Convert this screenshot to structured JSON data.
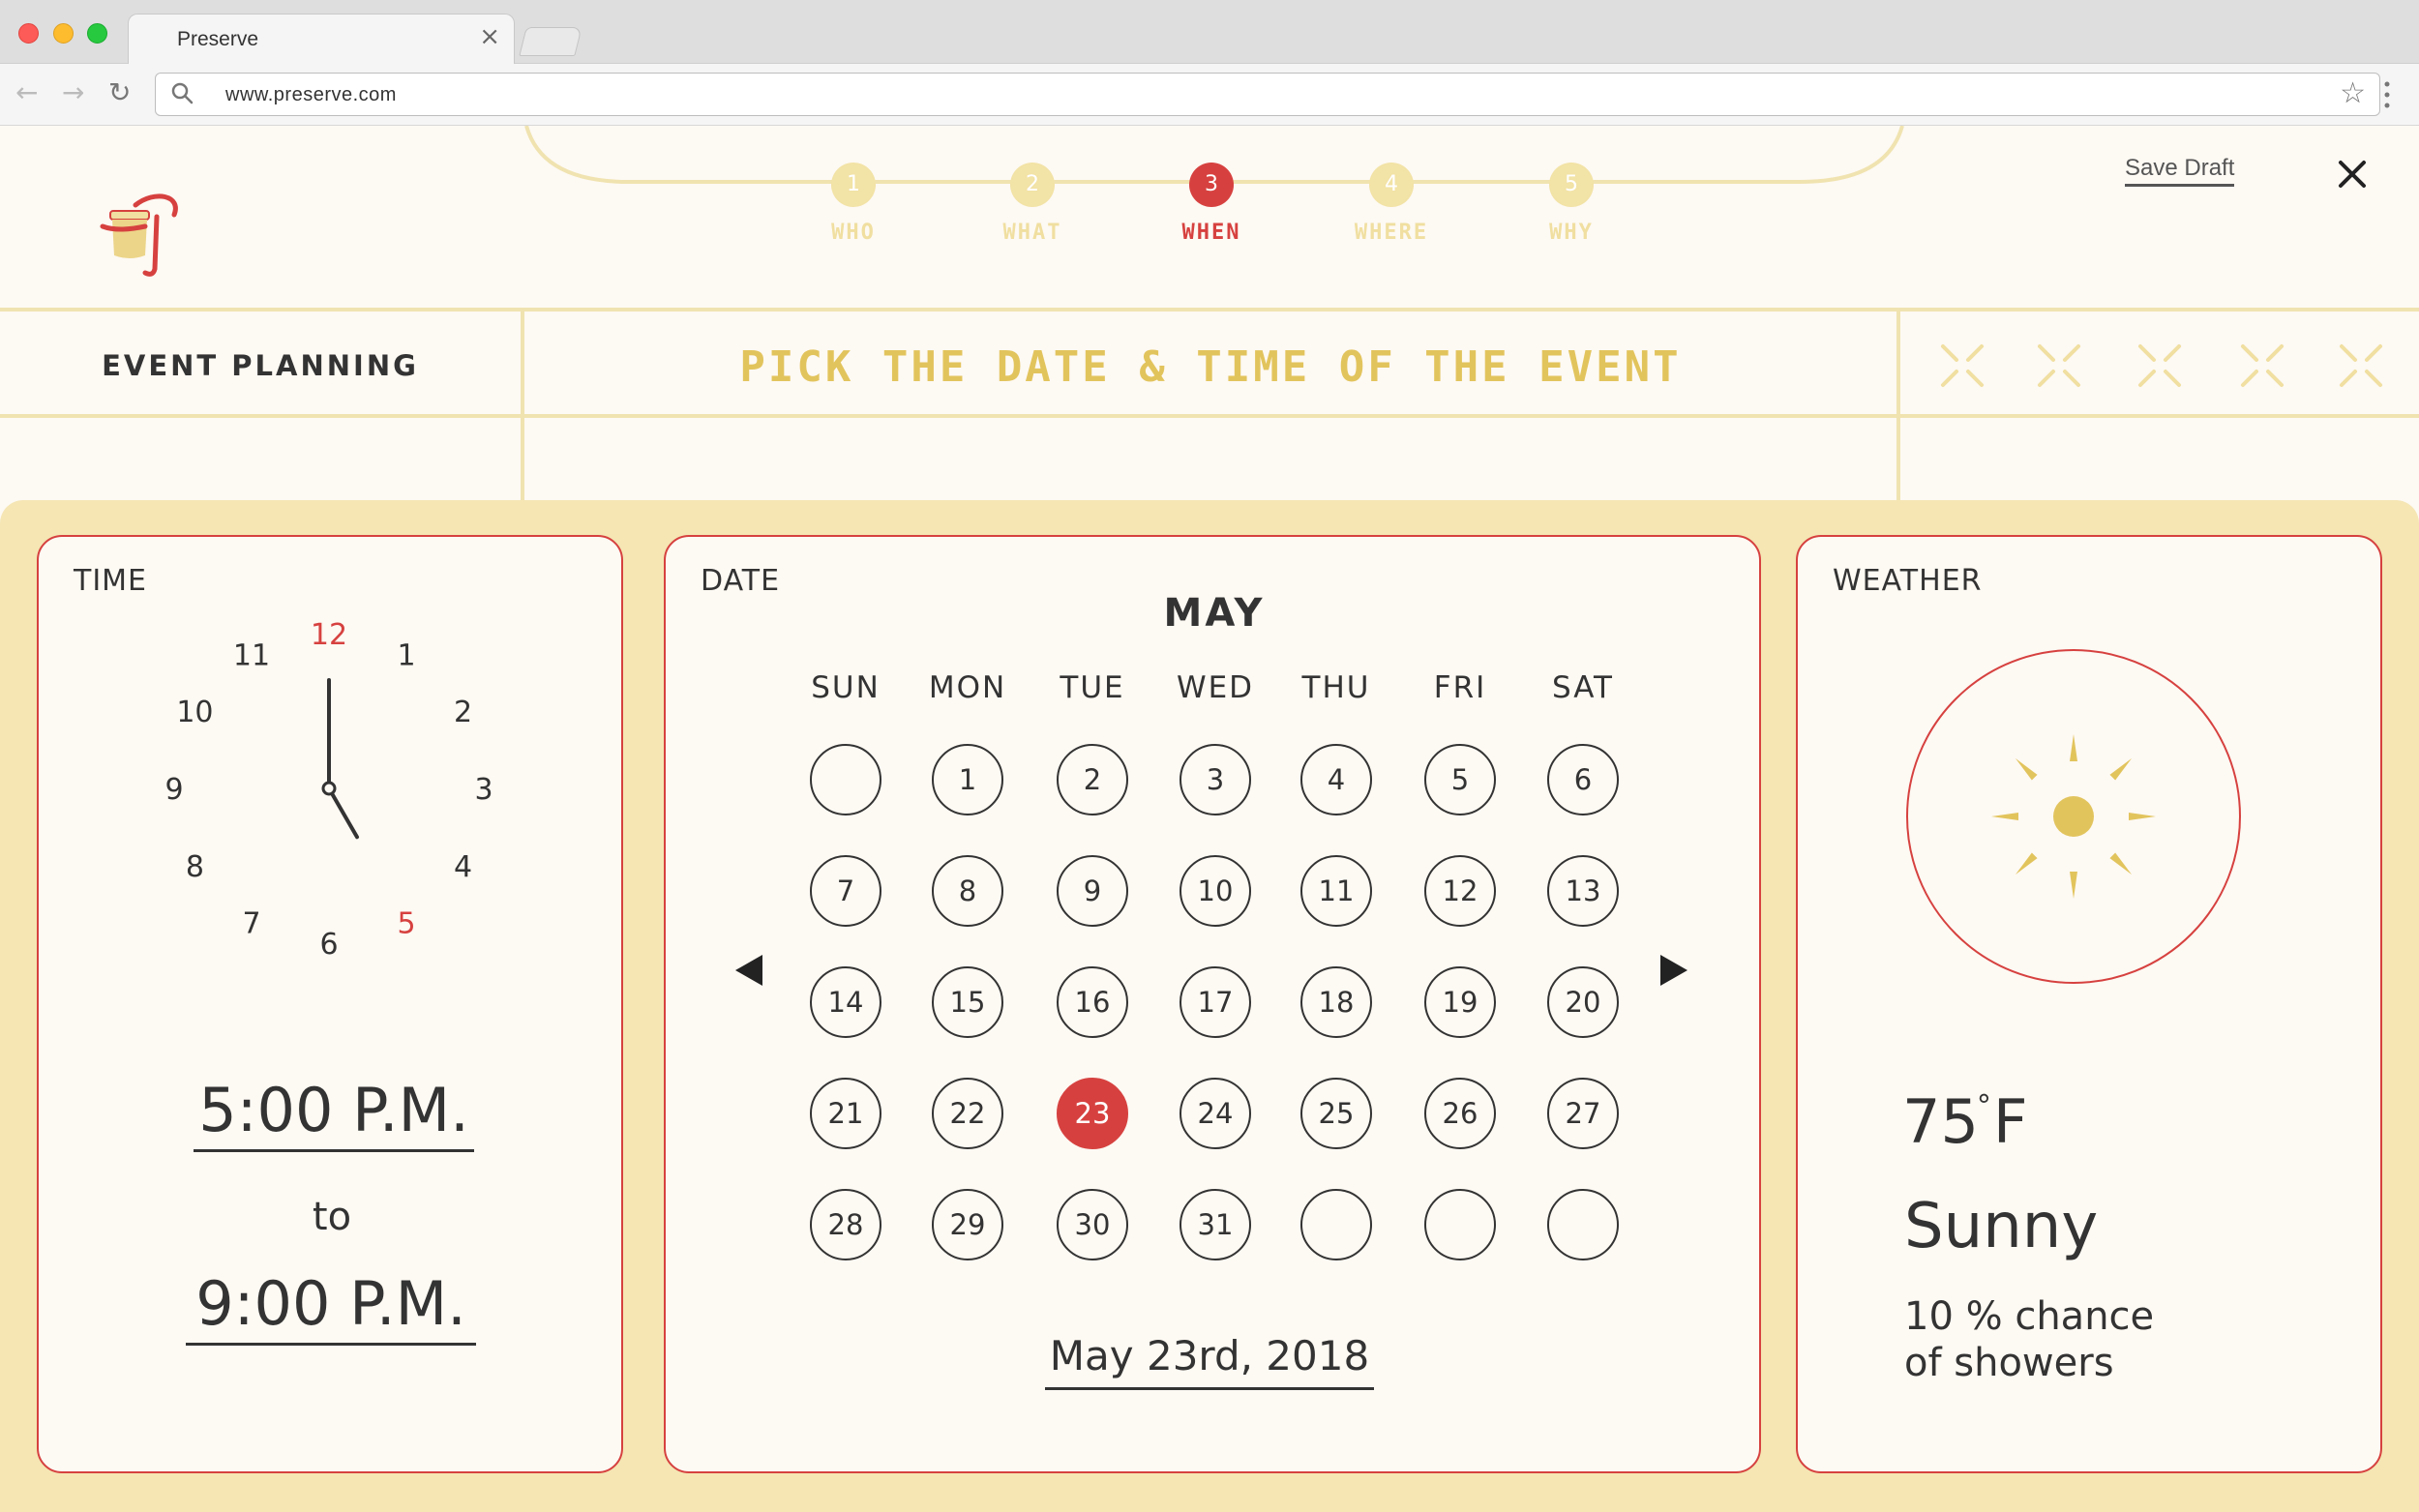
{
  "browser": {
    "tab_title": "Preserve",
    "tab_close": "×",
    "url": "www.preserve.com"
  },
  "header": {
    "steps": [
      {
        "number": "1",
        "label": "WHO",
        "active": false
      },
      {
        "number": "2",
        "label": "WHAT",
        "active": false
      },
      {
        "number": "3",
        "label": "WHEN",
        "active": true
      },
      {
        "number": "4",
        "label": "WHERE",
        "active": false
      },
      {
        "number": "5",
        "label": "WHY",
        "active": false
      }
    ],
    "save_draft": "Save Draft"
  },
  "band": {
    "section": "EVENT PLANNING",
    "title": "PICK THE DATE & TIME OF THE EVENT"
  },
  "time": {
    "label": "TIME",
    "clock_numbers": [
      "12",
      "1",
      "2",
      "3",
      "4",
      "5",
      "6",
      "7",
      "8",
      "9",
      "10",
      "11"
    ],
    "clock_highlighted": [
      "12",
      "5"
    ],
    "start": "5:00 P.M.",
    "connector": "to",
    "end": "9:00 P.M.",
    "hand_hour": 5,
    "hand_minute": 0
  },
  "date": {
    "label": "DATE",
    "month": "MAY",
    "weekdays": [
      "SUN",
      "MON",
      "TUE",
      "WED",
      "THU",
      "FRI",
      "SAT"
    ],
    "weeks": [
      [
        "",
        "1",
        "2",
        "3",
        "4",
        "5",
        "6"
      ],
      [
        "7",
        "8",
        "9",
        "10",
        "11",
        "12",
        "13"
      ],
      [
        "14",
        "15",
        "16",
        "17",
        "18",
        "19",
        "20"
      ],
      [
        "21",
        "22",
        "23",
        "24",
        "25",
        "26",
        "27"
      ],
      [
        "28",
        "29",
        "30",
        "31",
        "",
        "",
        ""
      ]
    ],
    "selected_day": "23",
    "selected_text": "May 23rd, 2018"
  },
  "weather": {
    "label": "WEATHER",
    "temp_value": "75",
    "temp_degree": "°",
    "temp_unit": "F",
    "condition": "Sunny",
    "chance": "10 % chance of showers",
    "icon": "sun-icon"
  },
  "colors": {
    "accent_red": "#d6413f",
    "accent_yellow": "#e2c45d",
    "background": "#fdf9f3",
    "panel_bg": "#f5e6b4"
  }
}
